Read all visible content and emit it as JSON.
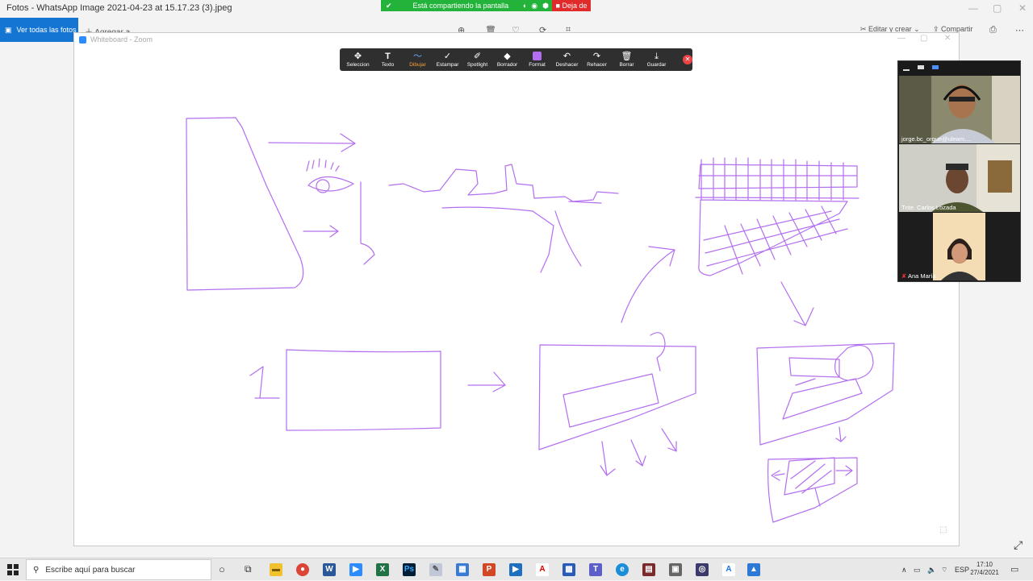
{
  "photos_app": {
    "title": "Fotos - WhatsApp Image 2021-04-23 at 15.17.23 (3).jpeg",
    "see_all_label": "Ver todas las fotos",
    "add_label": "Agregar a",
    "edit_create_label": "Editar y crear",
    "share_label": "Compartir"
  },
  "share_banner": {
    "text": "Está compartiendo la pantalla",
    "stop_label": "Deja de"
  },
  "zoom": {
    "window_title": "Whiteboard - Zoom",
    "tools": [
      {
        "label": "Seleccion",
        "glyph": "✥"
      },
      {
        "label": "Texto",
        "glyph": "T"
      },
      {
        "label": "Dibujar",
        "glyph": "〜"
      },
      {
        "label": "Estampar",
        "glyph": "✓"
      },
      {
        "label": "Spotlight",
        "glyph": "✐"
      },
      {
        "label": "Borrador",
        "glyph": "◆"
      },
      {
        "label": "Format",
        "glyph": ""
      },
      {
        "label": "Deshacer",
        "glyph": "↶"
      },
      {
        "label": "Rehacer",
        "glyph": "↷"
      },
      {
        "label": "Borrar",
        "glyph": "🗑"
      },
      {
        "label": "Guardar",
        "glyph": "⤓"
      }
    ],
    "active_tool": "Dibujar",
    "format_color": "#b36ff0",
    "drawing_color": "#b36ff0",
    "participants": [
      {
        "name": "jorge.bc_orque@uleam...."
      },
      {
        "name": "Tnte. Carlos Lozada"
      },
      {
        "name": "Ana María",
        "muted": true
      }
    ]
  },
  "taskbar": {
    "search_placeholder": "Escribe aquí para buscar",
    "language": "ESP",
    "time": "17:10",
    "date": "27/4/2021"
  }
}
